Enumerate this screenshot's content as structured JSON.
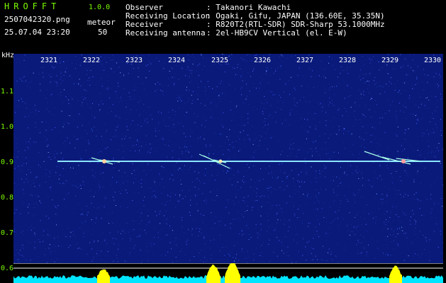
{
  "header": {
    "app_title": "HROFFT",
    "app_version": "1.0.0",
    "file_name": "2507042320.png",
    "meteor_label": "meteor",
    "datetime": "25.07.04 23:20",
    "meteor_count": "50"
  },
  "info": [
    {
      "key": "Observer",
      "value": ": Takanori Kawachi"
    },
    {
      "key": "Receiving Location",
      "value": ": Ogaki, Gifu, JAPAN (136.60E, 35.35N)"
    },
    {
      "key": "Receiver",
      "value": ": R820T2(RTL-SDR) SDR-Sharp 53.1000MHz"
    },
    {
      "key": "Receiving antenna",
      "value": ": 2el-HB9CV Vertical (el. E-W)"
    }
  ],
  "axes": {
    "y_unit": "kHz",
    "y_ticks": [
      "1.1",
      "1.0",
      "0.9",
      "0.8",
      "0.7",
      "0.6"
    ],
    "x_ticks": [
      "2321",
      "2322",
      "2323",
      "2324",
      "2325",
      "2326",
      "2327",
      "2328",
      "2329",
      "2330"
    ]
  },
  "colors": {
    "background": "#000000",
    "spectrogram_bg": "#0a1a7a",
    "header_text": "#7CFC00",
    "info_text": "#ffffff",
    "signal_line": "#c8ffff",
    "bottom_fill": "#00e5ff",
    "bottom_peaks": "#ffff00"
  }
}
